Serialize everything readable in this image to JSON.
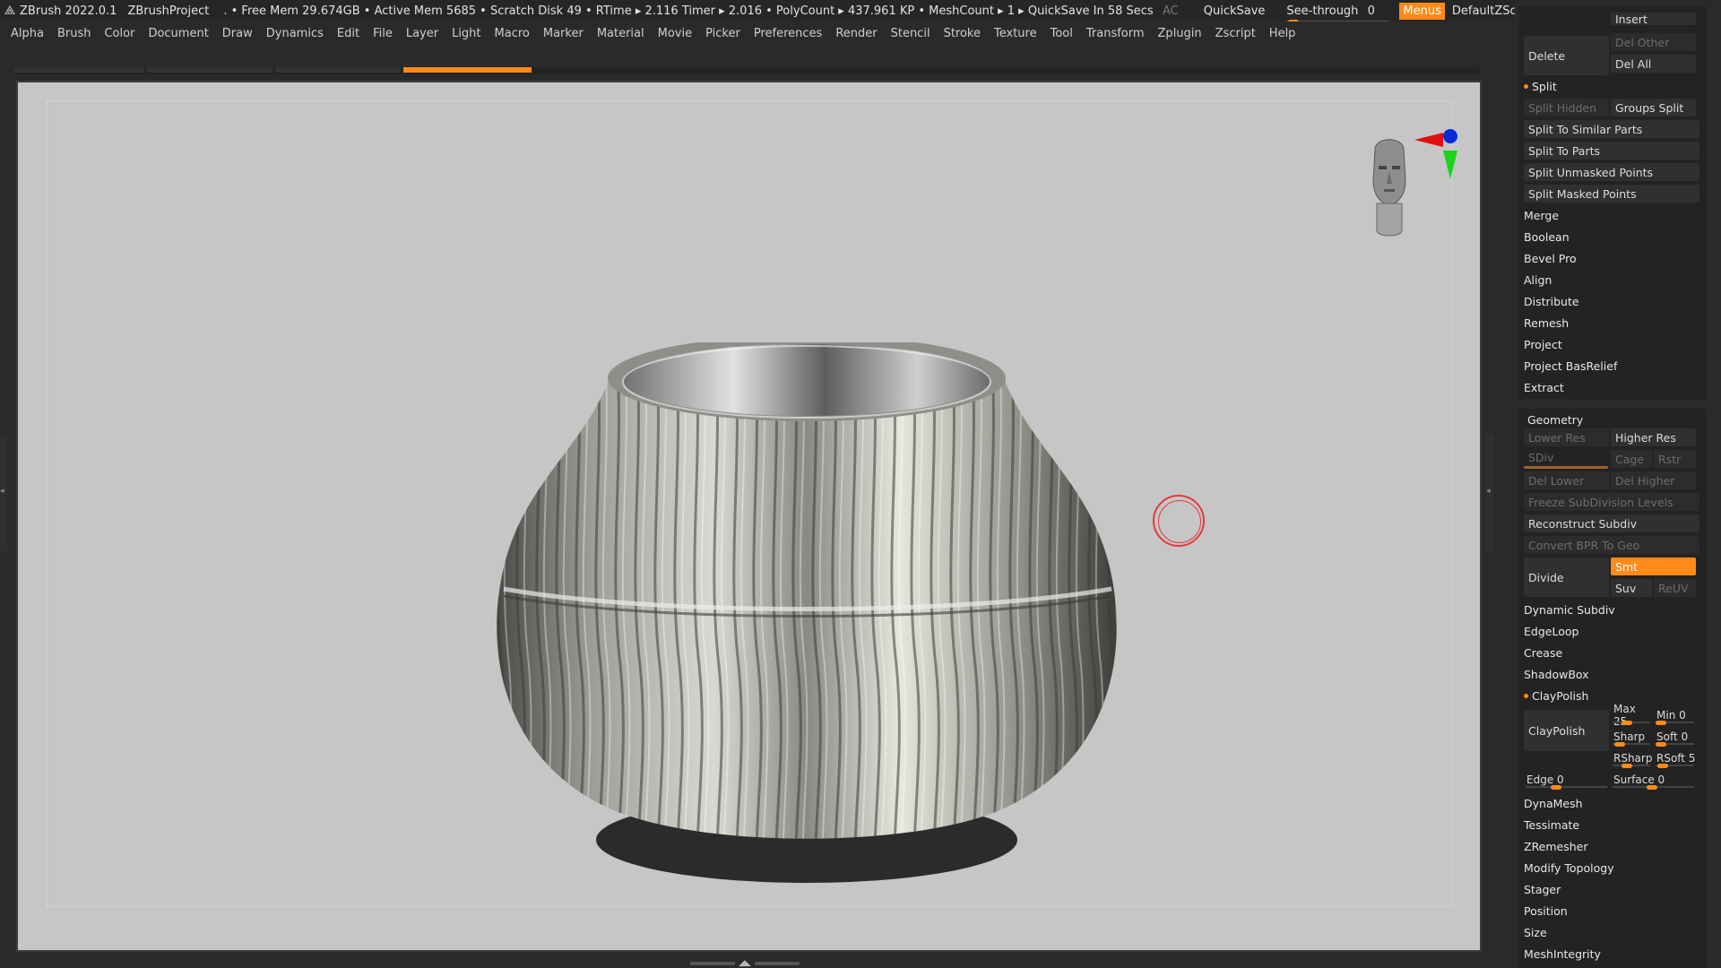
{
  "titlebar": {
    "app": "ZBrush 2022.0.1",
    "project": "ZBrushProject",
    "status": ". • Free Mem 29.674GB • Active Mem 5685 • Scratch Disk 49 •  RTime ▸ 2.116 Timer ▸ 2.016 • PolyCount ▸ 437.961 KP  • MeshCount ▸ 1  ▸ QuickSave In 58 Secs",
    "ac": "AC",
    "quicksave": "QuickSave",
    "seethrough_label": "See-through",
    "seethrough_value": "0",
    "menus": "Menus",
    "default_zscript": "DefaultZScript"
  },
  "menubar": [
    "Alpha",
    "Brush",
    "Color",
    "Document",
    "Draw",
    "Dynamics",
    "Edit",
    "File",
    "Layer",
    "Light",
    "Macro",
    "Marker",
    "Material",
    "Movie",
    "Picker",
    "Preferences",
    "Render",
    "Stencil",
    "Stroke",
    "Texture",
    "Tool",
    "Transform",
    "Zplugin",
    "Zscript",
    "Help"
  ],
  "panel": {
    "top": {
      "insert": "Insert",
      "delete": "Delete",
      "del_other": "Del Other",
      "del_all": "Del All"
    },
    "split": {
      "header": "Split",
      "split_hidden": "Split Hidden",
      "groups_split": "Groups Split",
      "items": [
        "Split To Similar Parts",
        "Split To Parts",
        "Split Unmasked Points",
        "Split Masked Points"
      ]
    },
    "subtool_items": [
      "Merge",
      "Boolean",
      "Bevel Pro",
      "Align",
      "Distribute",
      "Remesh",
      "Project",
      "Project BasRelief",
      "Extract"
    ],
    "geometry": {
      "header": "Geometry",
      "lower_res": "Lower Res",
      "higher_res": "Higher Res",
      "sdiv": "SDiv",
      "cage": "Cage",
      "rstr": "Rstr",
      "del_lower": "Del Lower",
      "del_higher": "Del Higher",
      "freeze": "Freeze SubDivision Levels",
      "reconstruct": "Reconstruct Subdiv",
      "convert_bpr": "Convert BPR To Geo",
      "divide": "Divide",
      "smt": "Smt",
      "suv": "Suv",
      "reuv": "ReUV",
      "dynamic_subdiv": "Dynamic Subdiv",
      "edgeloop": "EdgeLoop",
      "crease": "Crease",
      "shadowbox": "ShadowBox"
    },
    "claypolish": {
      "header": "ClayPolish",
      "button": "ClayPolish",
      "max_label": "Max 25",
      "min_label": "Min 0",
      "sharp_label": "Sharp",
      "soft_label": "Soft 0",
      "rsharp_label": "RSharp",
      "rsoft_label": "RSoft 5",
      "edge_label": "Edge 0",
      "surface_label": "Surface 0"
    },
    "bottom_items": [
      "DynaMesh",
      "Tessimate",
      "ZRemesher",
      "Modify Topology",
      "Stager",
      "Position",
      "Size",
      "MeshIntegrity"
    ]
  }
}
